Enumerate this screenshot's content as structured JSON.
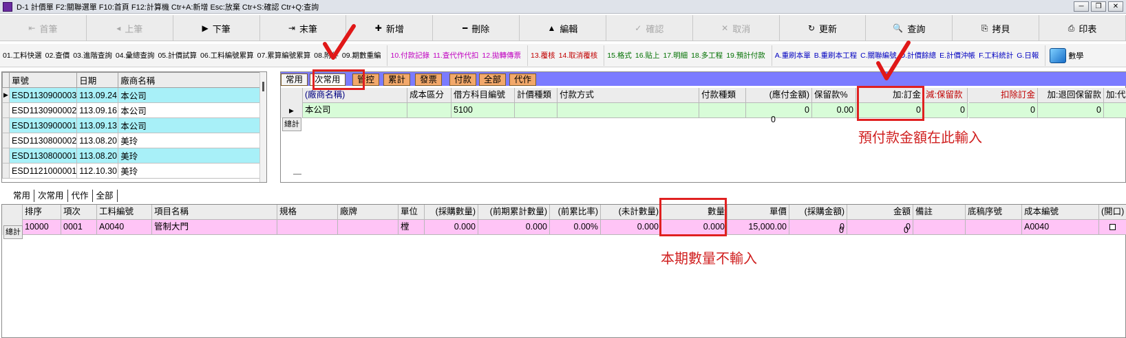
{
  "titlebar": {
    "text": "D-1 計價單   F2:關聯選單  F10:首頁  F12:計算機  Ctr+A:新增  Esc:放棄  Ctr+S:確認  Ctr+Q:查詢",
    "buttons": [
      "─",
      "❐",
      "✕"
    ]
  },
  "toolbar": [
    {
      "label": "首筆",
      "icon": "⇤",
      "disabled": true
    },
    {
      "label": "上筆",
      "icon": "◂",
      "disabled": true
    },
    {
      "label": "下筆",
      "icon": "▶",
      "disabled": false
    },
    {
      "label": "末筆",
      "icon": "⇥",
      "disabled": false
    },
    {
      "label": "新增",
      "icon": "✚",
      "disabled": false
    },
    {
      "label": "刪除",
      "icon": "━",
      "disabled": false
    },
    {
      "label": "編輯",
      "icon": "▲",
      "disabled": false
    },
    {
      "label": "確認",
      "icon": "✓",
      "disabled": true
    },
    {
      "label": "取消",
      "icon": "✕",
      "disabled": true
    },
    {
      "label": "更新",
      "icon": "↻",
      "disabled": false
    },
    {
      "label": "查詢",
      "icon": "🔍",
      "disabled": false
    },
    {
      "label": "拷貝",
      "icon": "⎘",
      "disabled": false
    },
    {
      "label": "印表",
      "icon": "⎙",
      "disabled": false
    }
  ],
  "funcbar": {
    "group1": [
      "01.工料快選",
      "02.查價",
      "03.進階查詢",
      "04.彙總查詢",
      "05.計價試算",
      "06.工料編號累算",
      "07.累算編號累算",
      "08.附件",
      "09.期數重編"
    ],
    "group2": [
      "10.付款記錄",
      "11.查代作代扣",
      "12.拋轉傳票"
    ],
    "group3": [
      "13.覆核",
      "14.取消覆核"
    ],
    "group4": [
      "15.格式",
      "16.貼上",
      "17.明細",
      "18.多工程",
      "19.預計付款"
    ],
    "group5": [
      "A.重刷本單",
      "B.重刷本工程",
      "C.關聯編號",
      "D.計價餘總",
      "E.計價沖帳",
      "F.工料統計",
      "G.日報"
    ],
    "math_label": "數學"
  },
  "left_grid": {
    "headers": [
      "單號",
      "日期",
      "廠商名稱"
    ],
    "rows": [
      {
        "no": "ESD1130900003",
        "date": "113.09.24",
        "vendor": "本公司",
        "selected": true
      },
      {
        "no": "ESD1130900002",
        "date": "113.09.16",
        "vendor": "本公司",
        "selected": false
      },
      {
        "no": "ESD1130900001",
        "date": "113.09.13",
        "vendor": "本公司",
        "selected": false
      },
      {
        "no": "ESD1130800002",
        "date": "113.08.20",
        "vendor": "美玲",
        "selected": false
      },
      {
        "no": "ESD1130800001",
        "date": "113.08.20",
        "vendor": "美玲",
        "selected": false
      },
      {
        "no": "ESD1121000001",
        "date": "112.10.30",
        "vendor": "美玲",
        "selected": false
      }
    ]
  },
  "right_tabs": [
    "常用",
    "次常用",
    "管控",
    "累計",
    "發票",
    "付款",
    "全部",
    "代作"
  ],
  "right_grid": {
    "headers": [
      "(廠商名稱)",
      "成本區分",
      "借方科目編號",
      "計價種類",
      "付款方式",
      "付款種類",
      "(應付金額)",
      "保留款%",
      "加:訂金",
      "減:保留款",
      "扣除訂金",
      "加:退回保留款",
      "加:代付"
    ],
    "row": [
      "本公司",
      "",
      "5100",
      "",
      "",
      "",
      "0",
      "0.00",
      "0",
      "0",
      "0",
      "0",
      ""
    ],
    "totals_label": "總計",
    "total_value": "0"
  },
  "bottom_tabs": [
    "常用",
    "次常用",
    "代作",
    "全部"
  ],
  "bottom_grid": {
    "headers": [
      "排序",
      "項次",
      "工料編號",
      "項目名稱",
      "規格",
      "廠牌",
      "單位",
      "(採購數量)",
      "(前期累計數量)",
      "(前累比率)",
      "(未計數量)",
      "數量",
      "單價",
      "(採購金額)",
      "金額",
      "備註",
      "底稿序號",
      "成本編號",
      "(開口)"
    ],
    "row": [
      "10000",
      "0001",
      "A0040",
      "管制大門",
      "",
      "",
      "樘",
      "0.000",
      "0.000",
      "0.00%",
      "0.000",
      "0.000",
      "15,000.00",
      "0",
      "0",
      "",
      "",
      "A0040",
      ""
    ],
    "totals_label": "總計",
    "totals": [
      "0",
      "0"
    ]
  },
  "annotations": {
    "prepay_note": "預付款金額在此輸入",
    "qty_note": "本期數量不輸入",
    "color": "#e02020"
  }
}
